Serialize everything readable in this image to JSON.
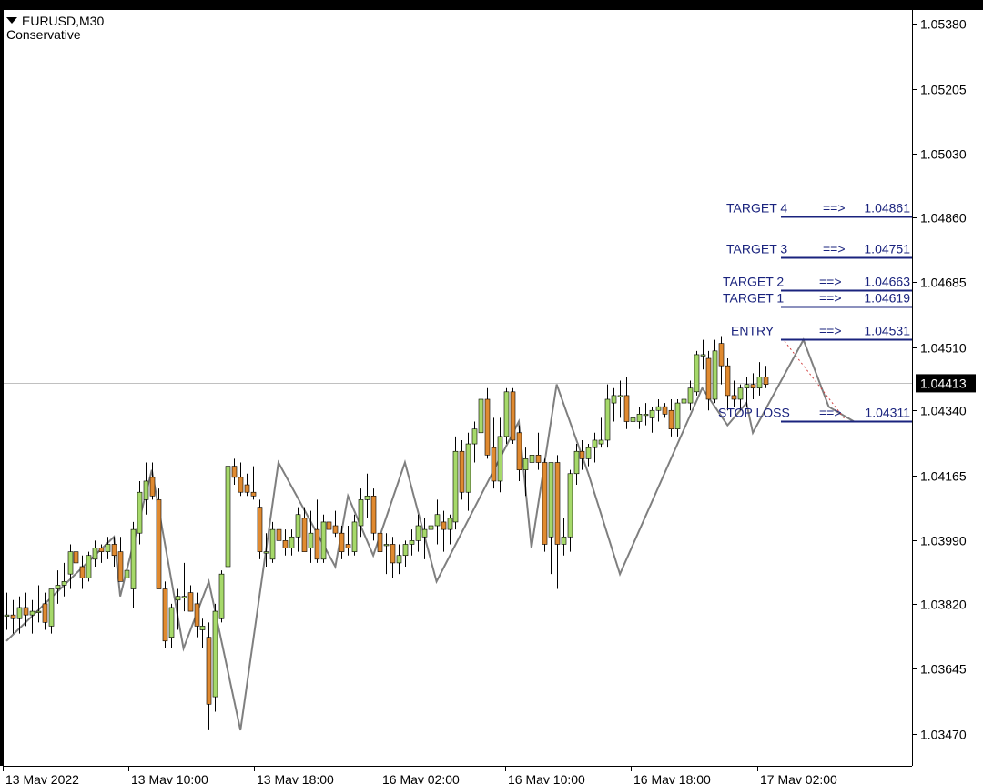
{
  "header": {
    "symbol": "EURUSD,M30",
    "indicator": "Conservative"
  },
  "price_badge": "1.04413",
  "levels": [
    {
      "name": "TARGET 4",
      "label": "TARGET 4",
      "arrow": "==>",
      "value": 1.04861,
      "value_text": "1.04861"
    },
    {
      "name": "TARGET 3",
      "label": "TARGET 3",
      "arrow": "==>",
      "value": 1.04751,
      "value_text": "1.04751"
    },
    {
      "name": "TARGET 2",
      "label": "TARGET 2",
      "arrow": "==>",
      "value": 1.04663,
      "value_text": "1.04663"
    },
    {
      "name": "TARGET 1",
      "label": "TARGET 1",
      "arrow": "==>",
      "value": 1.04619,
      "value_text": "1.04619"
    },
    {
      "name": "ENTRY",
      "label": "ENTRY",
      "arrow": "==>",
      "value": 1.04531,
      "value_text": "1.04531"
    },
    {
      "name": "STOP LOSS",
      "label": "STOP LOSS",
      "arrow": "==>",
      "value": 1.04311,
      "value_text": "1.04311"
    }
  ],
  "colors": {
    "background": "#ffffff",
    "frame": "#000000",
    "bull": "#a6d96a",
    "bear": "#e08a30",
    "wick": "#000000",
    "zigzag": "#7f7f7f",
    "level_line": "#1a237e",
    "level_text": "#1a237e",
    "current_line": "#c0c0c0",
    "badge_bg": "#000000",
    "badge_text": "#ffffff"
  },
  "chart_data": {
    "type": "candlestick",
    "symbol": "EURUSD",
    "timeframe": "M30",
    "ylim": [
      1.0343,
      1.0541
    ],
    "y_ticks": [
      "1.05380",
      "1.05205",
      "1.05030",
      "1.04860",
      "1.04685",
      "1.04510",
      "1.04340",
      "1.04165",
      "1.03990",
      "1.03820",
      "1.03645",
      "1.03470"
    ],
    "x_ticks": [
      "13 May 2022",
      "13 May 10:00",
      "13 May 18:00",
      "16 May 02:00",
      "16 May 10:00",
      "16 May 18:00",
      "17 May 02:00"
    ],
    "current_price": 1.04413,
    "candles": [
      {
        "o": 1.0379,
        "h": 1.0385,
        "l": 1.0375,
        "c": 1.0379
      },
      {
        "o": 1.0379,
        "h": 1.0383,
        "l": 1.0374,
        "c": 1.0378
      },
      {
        "o": 1.0378,
        "h": 1.0384,
        "l": 1.0374,
        "c": 1.0381
      },
      {
        "o": 1.0381,
        "h": 1.0385,
        "l": 1.0376,
        "c": 1.0379
      },
      {
        "o": 1.0379,
        "h": 1.0383,
        "l": 1.0374,
        "c": 1.038
      },
      {
        "o": 1.038,
        "h": 1.0387,
        "l": 1.0377,
        "c": 1.038
      },
      {
        "o": 1.0382,
        "h": 1.0385,
        "l": 1.0375,
        "c": 1.0377
      },
      {
        "o": 1.0376,
        "h": 1.0386,
        "l": 1.0374,
        "c": 1.0386
      },
      {
        "o": 1.0386,
        "h": 1.0391,
        "l": 1.0382,
        "c": 1.0387
      },
      {
        "o": 1.0387,
        "h": 1.0393,
        "l": 1.0384,
        "c": 1.0388
      },
      {
        "o": 1.039,
        "h": 1.0398,
        "l": 1.0386,
        "c": 1.0396
      },
      {
        "o": 1.0396,
        "h": 1.0398,
        "l": 1.0389,
        "c": 1.0393
      },
      {
        "o": 1.0392,
        "h": 1.0395,
        "l": 1.0386,
        "c": 1.0389
      },
      {
        "o": 1.0389,
        "h": 1.0396,
        "l": 1.0388,
        "c": 1.0395
      },
      {
        "o": 1.0394,
        "h": 1.0399,
        "l": 1.0392,
        "c": 1.0397
      },
      {
        "o": 1.0397,
        "h": 1.0398,
        "l": 1.0393,
        "c": 1.0396
      },
      {
        "o": 1.0396,
        "h": 1.04,
        "l": 1.0394,
        "c": 1.0398
      },
      {
        "o": 1.0398,
        "h": 1.04,
        "l": 1.0392,
        "c": 1.0395
      },
      {
        "o": 1.0396,
        "h": 1.04,
        "l": 1.0388,
        "c": 1.0388
      },
      {
        "o": 1.0389,
        "h": 1.0393,
        "l": 1.0385,
        "c": 1.0391
      },
      {
        "o": 1.0386,
        "h": 1.0404,
        "l": 1.0381,
        "c": 1.0402
      },
      {
        "o": 1.0401,
        "h": 1.0415,
        "l": 1.0398,
        "c": 1.0412
      },
      {
        "o": 1.041,
        "h": 1.042,
        "l": 1.0406,
        "c": 1.0415
      },
      {
        "o": 1.0416,
        "h": 1.042,
        "l": 1.041,
        "c": 1.0411
      },
      {
        "o": 1.041,
        "h": 1.0413,
        "l": 1.0388,
        "c": 1.0386
      },
      {
        "o": 1.0386,
        "h": 1.0388,
        "l": 1.037,
        "c": 1.0372
      },
      {
        "o": 1.0373,
        "h": 1.0382,
        "l": 1.037,
        "c": 1.0381
      },
      {
        "o": 1.0383,
        "h": 1.0386,
        "l": 1.0375,
        "c": 1.0384
      },
      {
        "o": 1.0384,
        "h": 1.0393,
        "l": 1.038,
        "c": 1.0384
      },
      {
        "o": 1.0385,
        "h": 1.0387,
        "l": 1.038,
        "c": 1.038
      },
      {
        "o": 1.0382,
        "h": 1.0385,
        "l": 1.0373,
        "c": 1.0376
      },
      {
        "o": 1.0375,
        "h": 1.0378,
        "l": 1.037,
        "c": 1.0376
      },
      {
        "o": 1.0373,
        "h": 1.0377,
        "l": 1.0348,
        "c": 1.0355
      },
      {
        "o": 1.0357,
        "h": 1.0382,
        "l": 1.0353,
        "c": 1.038
      },
      {
        "o": 1.0378,
        "h": 1.0391,
        "l": 1.0377,
        "c": 1.039
      },
      {
        "o": 1.0392,
        "h": 1.042,
        "l": 1.039,
        "c": 1.0419
      },
      {
        "o": 1.0419,
        "h": 1.0421,
        "l": 1.0414,
        "c": 1.0416
      },
      {
        "o": 1.0416,
        "h": 1.042,
        "l": 1.0411,
        "c": 1.0412
      },
      {
        "o": 1.0414,
        "h": 1.0417,
        "l": 1.0411,
        "c": 1.0412
      },
      {
        "o": 1.0412,
        "h": 1.0419,
        "l": 1.041,
        "c": 1.0411
      },
      {
        "o": 1.0408,
        "h": 1.041,
        "l": 1.0394,
        "c": 1.0396
      },
      {
        "o": 1.0396,
        "h": 1.0401,
        "l": 1.0392,
        "c": 1.0396
      },
      {
        "o": 1.0394,
        "h": 1.0404,
        "l": 1.0393,
        "c": 1.0402
      },
      {
        "o": 1.0402,
        "h": 1.0404,
        "l": 1.0396,
        "c": 1.0399
      },
      {
        "o": 1.0399,
        "h": 1.0402,
        "l": 1.0395,
        "c": 1.0397
      },
      {
        "o": 1.0397,
        "h": 1.0402,
        "l": 1.0395,
        "c": 1.04
      },
      {
        "o": 1.04,
        "h": 1.0408,
        "l": 1.0396,
        "c": 1.0406
      },
      {
        "o": 1.0405,
        "h": 1.0408,
        "l": 1.0396,
        "c": 1.0396
      },
      {
        "o": 1.0397,
        "h": 1.0407,
        "l": 1.0393,
        "c": 1.0401
      },
      {
        "o": 1.0402,
        "h": 1.041,
        "l": 1.0393,
        "c": 1.0394
      },
      {
        "o": 1.0394,
        "h": 1.0406,
        "l": 1.0393,
        "c": 1.0404
      },
      {
        "o": 1.0404,
        "h": 1.0407,
        "l": 1.04,
        "c": 1.0402
      },
      {
        "o": 1.0403,
        "h": 1.0407,
        "l": 1.04,
        "c": 1.0401
      },
      {
        "o": 1.0401,
        "h": 1.0403,
        "l": 1.0394,
        "c": 1.0396
      },
      {
        "o": 1.0398,
        "h": 1.0403,
        "l": 1.0395,
        "c": 1.0397
      },
      {
        "o": 1.0396,
        "h": 1.0406,
        "l": 1.0395,
        "c": 1.0404
      },
      {
        "o": 1.0403,
        "h": 1.0413,
        "l": 1.04,
        "c": 1.041
      },
      {
        "o": 1.041,
        "h": 1.0417,
        "l": 1.0405,
        "c": 1.0411
      },
      {
        "o": 1.0411,
        "h": 1.0413,
        "l": 1.0399,
        "c": 1.0401
      },
      {
        "o": 1.0401,
        "h": 1.0403,
        "l": 1.0395,
        "c": 1.0396
      },
      {
        "o": 1.0398,
        "h": 1.0401,
        "l": 1.039,
        "c": 1.0398
      },
      {
        "o": 1.0398,
        "h": 1.04,
        "l": 1.0389,
        "c": 1.0393
      },
      {
        "o": 1.0393,
        "h": 1.0398,
        "l": 1.039,
        "c": 1.0395
      },
      {
        "o": 1.0395,
        "h": 1.0399,
        "l": 1.0392,
        "c": 1.0398
      },
      {
        "o": 1.0398,
        "h": 1.0402,
        "l": 1.0395,
        "c": 1.0399
      },
      {
        "o": 1.0399,
        "h": 1.0406,
        "l": 1.0396,
        "c": 1.0403
      },
      {
        "o": 1.04,
        "h": 1.0405,
        "l": 1.0394,
        "c": 1.0402
      },
      {
        "o": 1.0402,
        "h": 1.0407,
        "l": 1.0396,
        "c": 1.0403
      },
      {
        "o": 1.0403,
        "h": 1.041,
        "l": 1.0398,
        "c": 1.0406
      },
      {
        "o": 1.0404,
        "h": 1.0407,
        "l": 1.0396,
        "c": 1.0402
      },
      {
        "o": 1.0402,
        "h": 1.0406,
        "l": 1.0398,
        "c": 1.0405
      },
      {
        "o": 1.0404,
        "h": 1.0427,
        "l": 1.0402,
        "c": 1.0423
      },
      {
        "o": 1.0423,
        "h": 1.0426,
        "l": 1.041,
        "c": 1.0412
      },
      {
        "o": 1.0412,
        "h": 1.0428,
        "l": 1.0407,
        "c": 1.0425
      },
      {
        "o": 1.0425,
        "h": 1.0431,
        "l": 1.042,
        "c": 1.0429
      },
      {
        "o": 1.0428,
        "h": 1.0438,
        "l": 1.0424,
        "c": 1.0437
      },
      {
        "o": 1.0437,
        "h": 1.044,
        "l": 1.0421,
        "c": 1.0422
      },
      {
        "o": 1.0424,
        "h": 1.0432,
        "l": 1.0413,
        "c": 1.0415
      },
      {
        "o": 1.0415,
        "h": 1.0432,
        "l": 1.0412,
        "c": 1.0427
      },
      {
        "o": 1.0427,
        "h": 1.044,
        "l": 1.0425,
        "c": 1.0439
      },
      {
        "o": 1.0439,
        "h": 1.044,
        "l": 1.0425,
        "c": 1.0426
      },
      {
        "o": 1.0428,
        "h": 1.043,
        "l": 1.0415,
        "c": 1.0418
      },
      {
        "o": 1.0418,
        "h": 1.0424,
        "l": 1.0411,
        "c": 1.0421
      },
      {
        "o": 1.042,
        "h": 1.0424,
        "l": 1.0417,
        "c": 1.0422
      },
      {
        "o": 1.0422,
        "h": 1.0428,
        "l": 1.0418,
        "c": 1.042
      },
      {
        "o": 1.042,
        "h": 1.0421,
        "l": 1.0396,
        "c": 1.0398
      },
      {
        "o": 1.04,
        "h": 1.042,
        "l": 1.039,
        "c": 1.042
      },
      {
        "o": 1.042,
        "h": 1.0422,
        "l": 1.0386,
        "c": 1.0398
      },
      {
        "o": 1.0398,
        "h": 1.0405,
        "l": 1.0395,
        "c": 1.04
      },
      {
        "o": 1.04,
        "h": 1.0418,
        "l": 1.0396,
        "c": 1.0417
      },
      {
        "o": 1.0417,
        "h": 1.0425,
        "l": 1.0414,
        "c": 1.0423
      },
      {
        "o": 1.0423,
        "h": 1.0426,
        "l": 1.0418,
        "c": 1.0421
      },
      {
        "o": 1.0421,
        "h": 1.0425,
        "l": 1.0419,
        "c": 1.0424
      },
      {
        "o": 1.0424,
        "h": 1.0428,
        "l": 1.042,
        "c": 1.0426
      },
      {
        "o": 1.0425,
        "h": 1.0432,
        "l": 1.0424,
        "c": 1.0426
      },
      {
        "o": 1.0426,
        "h": 1.0441,
        "l": 1.0424,
        "c": 1.0437
      },
      {
        "o": 1.0436,
        "h": 1.044,
        "l": 1.0431,
        "c": 1.0438
      },
      {
        "o": 1.0438,
        "h": 1.0442,
        "l": 1.0432,
        "c": 1.0438
      },
      {
        "o": 1.0438,
        "h": 1.0443,
        "l": 1.0429,
        "c": 1.0431
      },
      {
        "o": 1.0431,
        "h": 1.0434,
        "l": 1.0428,
        "c": 1.0432
      },
      {
        "o": 1.0431,
        "h": 1.0435,
        "l": 1.0429,
        "c": 1.0433
      },
      {
        "o": 1.0433,
        "h": 1.0436,
        "l": 1.043,
        "c": 1.0433
      },
      {
        "o": 1.0432,
        "h": 1.0435,
        "l": 1.0428,
        "c": 1.0434
      },
      {
        "o": 1.0434,
        "h": 1.0437,
        "l": 1.0431,
        "c": 1.0435
      },
      {
        "o": 1.0435,
        "h": 1.0436,
        "l": 1.0432,
        "c": 1.0433
      },
      {
        "o": 1.0434,
        "h": 1.0437,
        "l": 1.0427,
        "c": 1.0429
      },
      {
        "o": 1.0429,
        "h": 1.0437,
        "l": 1.0427,
        "c": 1.0436
      },
      {
        "o": 1.0436,
        "h": 1.0439,
        "l": 1.0433,
        "c": 1.0437
      },
      {
        "o": 1.0436,
        "h": 1.0442,
        "l": 1.0434,
        "c": 1.044
      },
      {
        "o": 1.0439,
        "h": 1.045,
        "l": 1.0438,
        "c": 1.0449
      },
      {
        "o": 1.0449,
        "h": 1.0453,
        "l": 1.0445,
        "c": 1.0449
      },
      {
        "o": 1.0448,
        "h": 1.045,
        "l": 1.0434,
        "c": 1.0437
      },
      {
        "o": 1.0437,
        "h": 1.0453,
        "l": 1.0436,
        "c": 1.045
      },
      {
        "o": 1.0452,
        "h": 1.0454,
        "l": 1.0441,
        "c": 1.0446
      },
      {
        "o": 1.0446,
        "h": 1.0448,
        "l": 1.0434,
        "c": 1.0438
      },
      {
        "o": 1.0438,
        "h": 1.0442,
        "l": 1.0435,
        "c": 1.0437
      },
      {
        "o": 1.0437,
        "h": 1.0441,
        "l": 1.0434,
        "c": 1.044
      },
      {
        "o": 1.044,
        "h": 1.0443,
        "l": 1.0435,
        "c": 1.0441
      },
      {
        "o": 1.0441,
        "h": 1.0444,
        "l": 1.0437,
        "c": 1.044
      },
      {
        "o": 1.044,
        "h": 1.0447,
        "l": 1.0438,
        "c": 1.0443
      },
      {
        "o": 1.0443,
        "h": 1.0446,
        "l": 1.044,
        "c": 1.0441
      }
    ],
    "zigzag": [
      {
        "i": 0,
        "y": 1.0372
      },
      {
        "i": 17,
        "y": 1.04
      },
      {
        "i": 18,
        "y": 1.0384
      },
      {
        "i": 23,
        "y": 1.0418
      },
      {
        "i": 28,
        "y": 1.037
      },
      {
        "i": 32,
        "y": 1.0388
      },
      {
        "i": 37,
        "y": 1.0348
      },
      {
        "i": 43,
        "y": 1.042
      },
      {
        "i": 52,
        "y": 1.0392
      },
      {
        "i": 54,
        "y": 1.0411
      },
      {
        "i": 58,
        "y": 1.0395
      },
      {
        "i": 63,
        "y": 1.042
      },
      {
        "i": 68,
        "y": 1.0388
      },
      {
        "i": 81,
        "y": 1.0431
      },
      {
        "i": 83,
        "y": 1.0397
      },
      {
        "i": 87,
        "y": 1.0441
      },
      {
        "i": 92,
        "y": 1.0417
      },
      {
        "i": 97,
        "y": 1.039
      },
      {
        "i": 110,
        "y": 1.044
      },
      {
        "i": 114,
        "y": 1.043
      },
      {
        "i": 117,
        "y": 1.0436
      },
      {
        "i": 118,
        "y": 1.0428
      },
      {
        "i": 126,
        "y": 1.0453
      },
      {
        "i": 130,
        "y": 1.0435
      },
      {
        "i": 134,
        "y": 1.0431
      }
    ]
  }
}
